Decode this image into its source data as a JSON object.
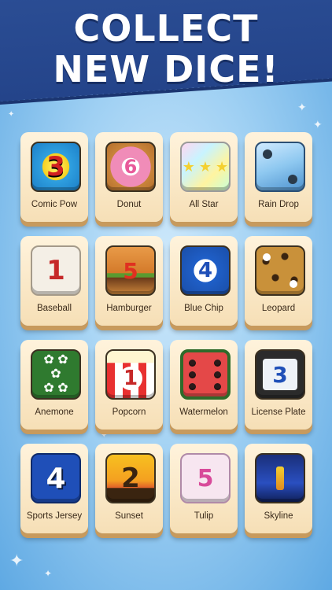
{
  "header": {
    "title_line1": "COLLECT",
    "title_line2": "NEW DICE!"
  },
  "dice": [
    {
      "label": "Comic Pow",
      "face": "3",
      "icon": "comic-pow-dice-icon",
      "color": "#f6d020"
    },
    {
      "label": "Donut",
      "face": "6",
      "icon": "donut-dice-icon",
      "color": "#f0a0c0"
    },
    {
      "label": "All Star",
      "face": "",
      "icon": "all-star-dice-icon",
      "color": "#b8f0d0"
    },
    {
      "label": "Rain Drop",
      "face": "",
      "icon": "rain-drop-dice-icon",
      "color": "#8ec8f0"
    },
    {
      "label": "Baseball",
      "face": "1",
      "icon": "baseball-dice-icon",
      "color": "#f4efe6"
    },
    {
      "label": "Hamburger",
      "face": "5",
      "icon": "hamburger-dice-icon",
      "color": "#e08a38"
    },
    {
      "label": "Blue Chip",
      "face": "4",
      "icon": "blue-chip-dice-icon",
      "color": "#1f5fc8"
    },
    {
      "label": "Leopard",
      "face": "",
      "icon": "leopard-dice-icon",
      "color": "#c9913a"
    },
    {
      "label": "Anemone",
      "face": "",
      "icon": "anemone-dice-icon",
      "color": "#2f7a2f"
    },
    {
      "label": "Popcorn",
      "face": "1",
      "icon": "popcorn-dice-icon",
      "color": "#e83030"
    },
    {
      "label": "Watermelon",
      "face": "",
      "icon": "watermelon-dice-icon",
      "color": "#e44848"
    },
    {
      "label": "License Plate",
      "face": "3",
      "icon": "license-plate-dice-icon",
      "color": "#eef2f8"
    },
    {
      "label": "Sports Jersey",
      "face": "4",
      "icon": "sports-jersey-dice-icon",
      "color": "#1f4fb8"
    },
    {
      "label": "Sunset",
      "face": "2",
      "icon": "sunset-dice-icon",
      "color": "#f4a020"
    },
    {
      "label": "Tulip",
      "face": "5",
      "icon": "tulip-dice-icon",
      "color": "#f7e6f0"
    },
    {
      "label": "Skyline",
      "face": "",
      "icon": "skyline-dice-icon",
      "color": "#1a2f7a"
    }
  ]
}
